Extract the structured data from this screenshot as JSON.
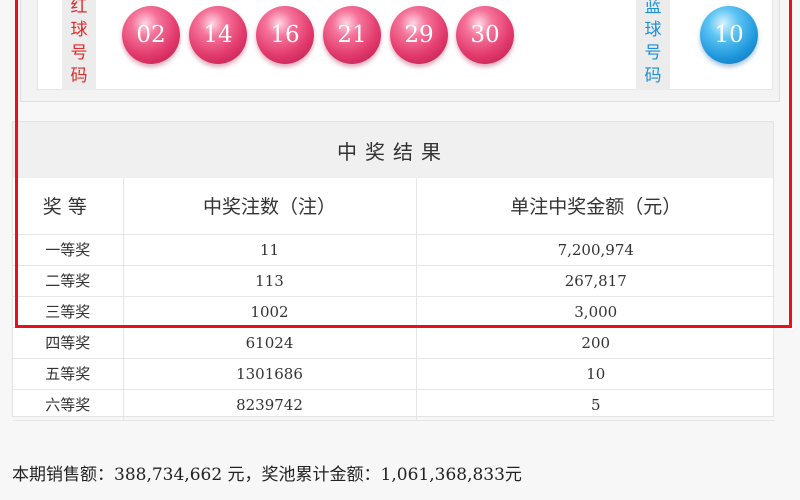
{
  "balls": {
    "red_label": [
      "红",
      "球",
      "号",
      "码"
    ],
    "red": [
      "02",
      "14",
      "16",
      "21",
      "29",
      "30"
    ],
    "blue_label": [
      "蓝",
      "球",
      "号",
      "码"
    ],
    "blue": [
      "10"
    ],
    "red_color": "#e23a6c",
    "blue_color": "#1e96dc"
  },
  "results": {
    "title": "中奖结果",
    "headers": [
      "奖等",
      "中奖注数（注）",
      "单注中奖金额（元）"
    ],
    "rows": [
      {
        "level": "一等奖",
        "count": "11",
        "amount": "7,200,974"
      },
      {
        "level": "二等奖",
        "count": "113",
        "amount": "267,817"
      },
      {
        "level": "三等奖",
        "count": "1002",
        "amount": "3,000"
      },
      {
        "level": "四等奖",
        "count": "61024",
        "amount": "200"
      },
      {
        "level": "五等奖",
        "count": "1301686",
        "amount": "10"
      },
      {
        "level": "六等奖",
        "count": "8239742",
        "amount": "5"
      }
    ]
  },
  "footer": {
    "sales": "本期销售额：388,734,662 元，奖池累计金额：1,061,368,833元"
  },
  "highlight_color": "#e8101c"
}
